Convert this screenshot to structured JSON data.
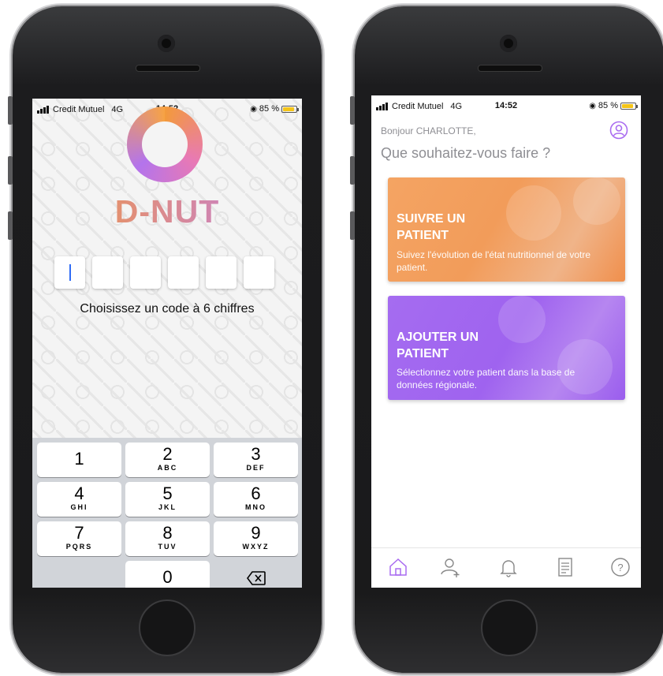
{
  "colors": {
    "accent_purple": "#a96bf0",
    "accent_orange": "#f29c5a",
    "caret_blue": "#2f6cf5",
    "battery_yellow": "#f5c518"
  },
  "left_screen": {
    "status": {
      "carrier": "Credit Mutuel",
      "network": "4G",
      "time": "14:52",
      "battery": "85 %"
    },
    "app_name": "D-NUT",
    "code_length": 6,
    "prompt": "Choisissez un code à 6 chiffres",
    "keypad": [
      {
        "num": "1",
        "letters": ""
      },
      {
        "num": "2",
        "letters": "ABC"
      },
      {
        "num": "3",
        "letters": "DEF"
      },
      {
        "num": "4",
        "letters": "GHI"
      },
      {
        "num": "5",
        "letters": "JKL"
      },
      {
        "num": "6",
        "letters": "MNO"
      },
      {
        "num": "7",
        "letters": "PQRS"
      },
      {
        "num": "8",
        "letters": "TUV"
      },
      {
        "num": "9",
        "letters": "WXYZ"
      },
      {
        "num": "0",
        "letters": ""
      }
    ],
    "delete_icon": "backspace-icon"
  },
  "right_screen": {
    "status": {
      "carrier": "Credit Mutuel",
      "network": "4G",
      "time": "14:52",
      "battery": "85 %"
    },
    "greeting": "Bonjour CHARLOTTE,",
    "question": "Que souhaitez-vous faire ?",
    "cards": [
      {
        "title": "SUIVRE UN PATIENT",
        "description": "Suivez l'évolution de l'état nutritionnel de votre patient."
      },
      {
        "title": "AJOUTER UN PATIENT",
        "description": "Sélectionnez votre patient dans la base de données régionale."
      }
    ],
    "tabs": [
      "home-icon",
      "add-user-icon",
      "bell-icon",
      "document-icon",
      "help-icon"
    ]
  }
}
